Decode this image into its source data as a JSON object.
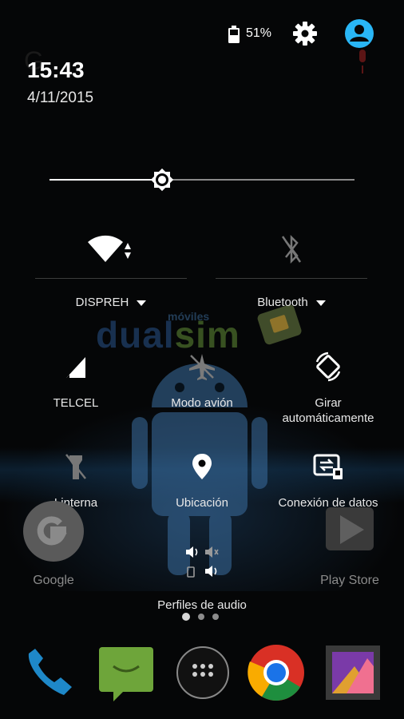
{
  "status_bar": {
    "battery_percent": "51%",
    "battery_level": 0.51
  },
  "clock": {
    "time": "15:43",
    "date": "4/11/2015"
  },
  "brightness": {
    "level": 0.37
  },
  "wifi": {
    "label": "DISPREH",
    "icon": "wifi-icon"
  },
  "bluetooth": {
    "label": "Bluetooth",
    "icon": "bluetooth-icon"
  },
  "wallpaper": {
    "brand_small": "móviles",
    "brand_left": "dual",
    "brand_right": "sim"
  },
  "tiles": [
    {
      "label": "TELCEL",
      "icon": "signal-icon"
    },
    {
      "label": "Modo avión",
      "icon": "airplane-icon"
    },
    {
      "label": "Girar automáticamente",
      "icon": "rotate-icon"
    },
    {
      "label": "Linterna",
      "icon": "flashlight-icon"
    },
    {
      "label": "Ubicación",
      "icon": "location-icon"
    },
    {
      "label": "Conexión de datos",
      "icon": "data-connection-icon"
    }
  ],
  "audio_profiles": {
    "label": "Perfiles de audio",
    "icon": "audio-profiles-icon"
  },
  "pager": {
    "pages": 3,
    "active": 0
  },
  "home_apps": {
    "google": "Google",
    "play_store": "Play Store"
  },
  "colors": {
    "accent": "#29b6f6",
    "background": "#050607"
  }
}
